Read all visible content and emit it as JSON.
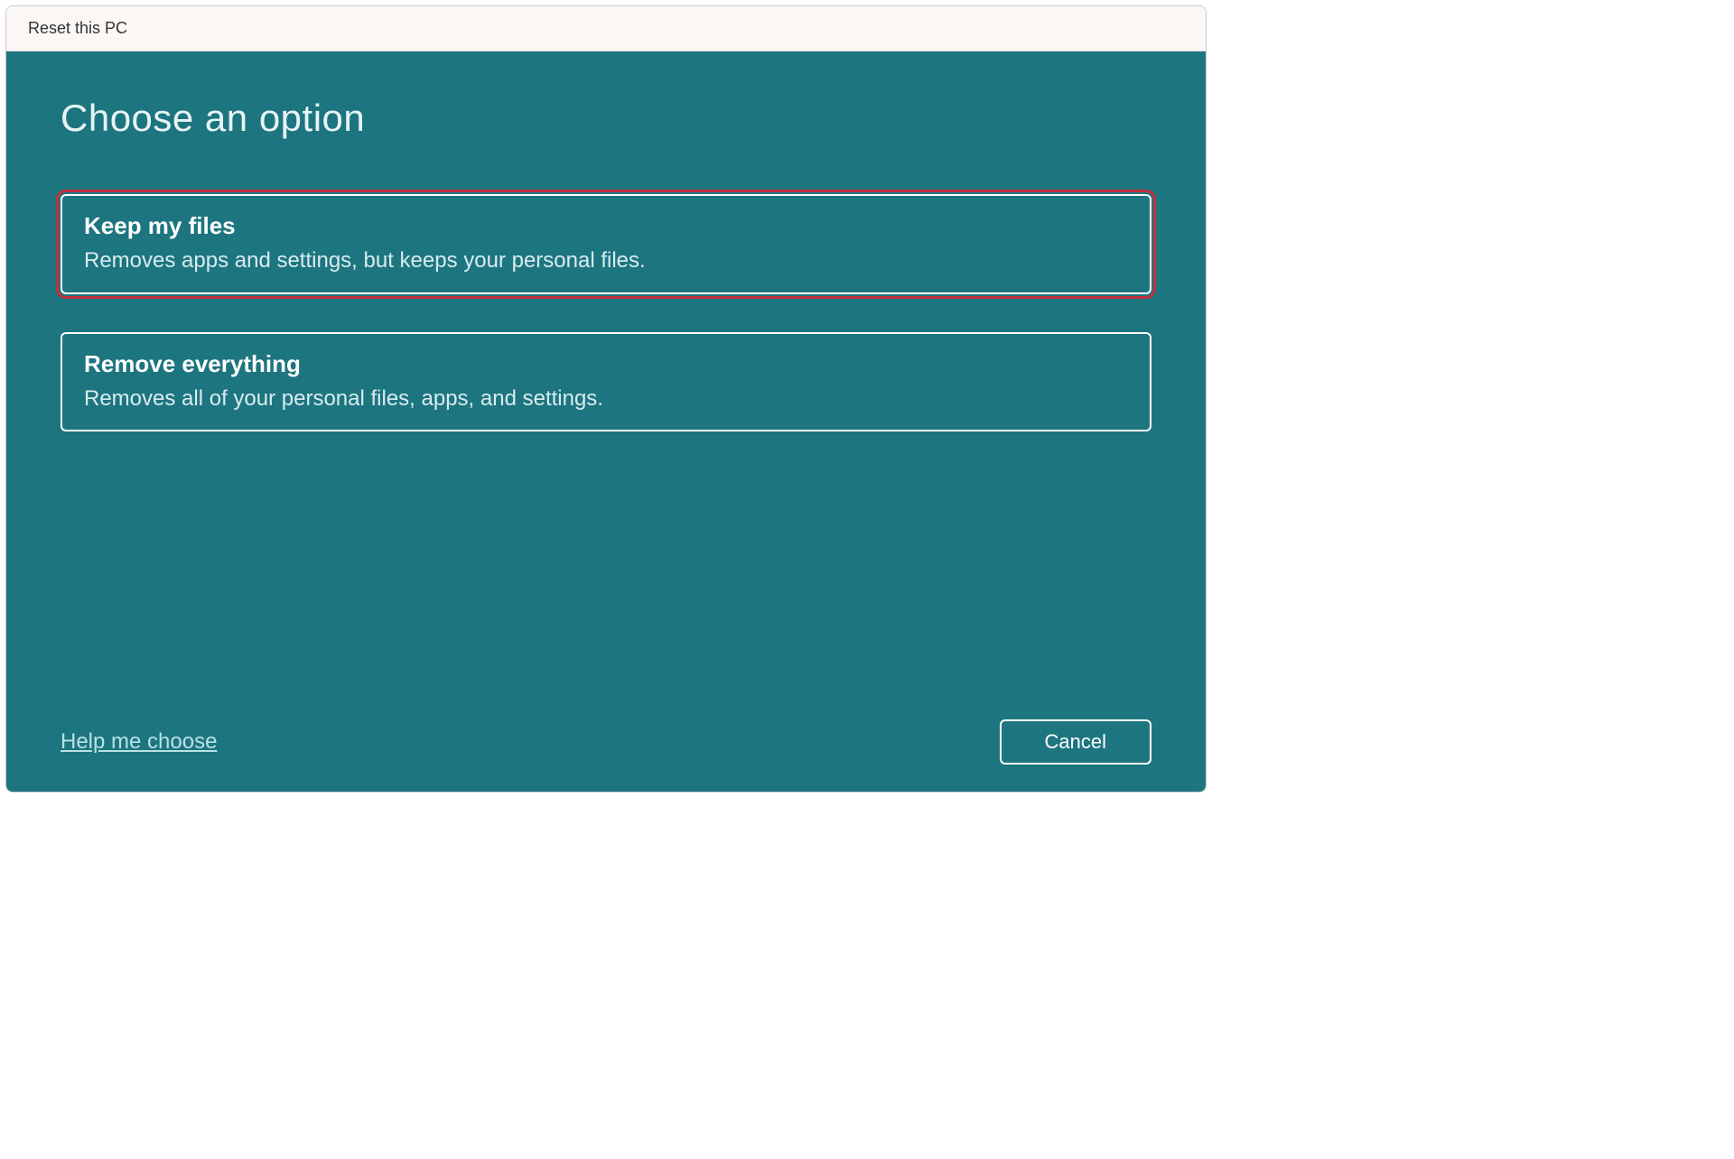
{
  "window": {
    "title": "Reset this PC"
  },
  "main": {
    "heading": "Choose an option",
    "options": [
      {
        "title": "Keep my files",
        "description": "Removes apps and settings, but keeps your personal files."
      },
      {
        "title": "Remove everything",
        "description": "Removes all of your personal files, apps, and settings."
      }
    ]
  },
  "footer": {
    "help_link": "Help me choose",
    "cancel_label": "Cancel"
  },
  "colors": {
    "dialog_bg": "#1d7580",
    "titlebar_bg": "#faf7f5",
    "text_light": "#e8f4f5",
    "highlight_outline": "#c2303f"
  }
}
